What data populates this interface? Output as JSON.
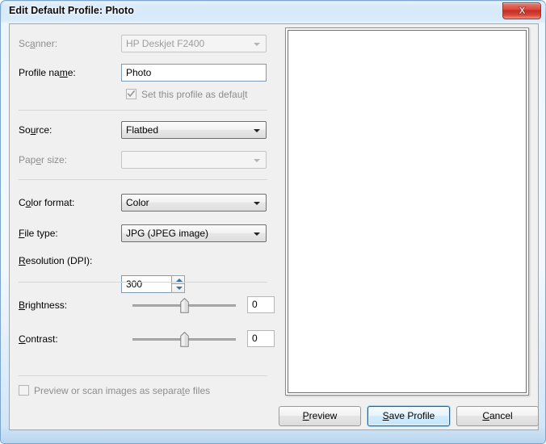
{
  "window": {
    "title": "Edit Default Profile: Photo",
    "close_icon": "close-icon",
    "accent_blue": "#9fd2f2",
    "frame_blue": "#bcd9f4",
    "client_bg": "#f0f0f0",
    "close_red": "#c42b20"
  },
  "fields": {
    "scanner": {
      "label_pre": "Sc",
      "label_accel": "a",
      "label_post": "nner:",
      "value": "HP Deskjet F2400",
      "enabled": false
    },
    "profile_name": {
      "label_pre": "Profile na",
      "label_accel": "m",
      "label_post": "e:",
      "value": "Photo",
      "enabled": true
    },
    "set_default": {
      "label_pre": "Set this profile as defau",
      "label_accel": "l",
      "label_post": "t",
      "checked": true,
      "enabled": false
    },
    "source": {
      "label_pre": "So",
      "label_accel": "u",
      "label_post": "rce:",
      "value": "Flatbed",
      "enabled": true
    },
    "paper_size": {
      "label_pre": "Pap",
      "label_accel": "e",
      "label_post": "r size:",
      "value": "",
      "enabled": false
    },
    "color_format": {
      "label_pre": "C",
      "label_accel": "o",
      "label_post": "lor format:",
      "value": "Color",
      "enabled": true
    },
    "file_type": {
      "label_pre": "",
      "label_accel": "F",
      "label_post": "ile type:",
      "value": "JPG (JPEG image)",
      "enabled": true
    },
    "resolution": {
      "label_pre": "",
      "label_accel": "R",
      "label_post": "esolution (DPI):",
      "value": "300",
      "enabled": true
    },
    "brightness": {
      "label_pre": "",
      "label_accel": "B",
      "label_post": "rightness:",
      "value": "0",
      "slider_percent": 50
    },
    "contrast": {
      "label_pre": "",
      "label_accel": "C",
      "label_post": "ontrast:",
      "value": "0",
      "slider_percent": 50
    },
    "separate_files": {
      "label_pre": "Preview or scan images as separa",
      "label_accel": "t",
      "label_post": "e files",
      "checked": false,
      "enabled": false
    }
  },
  "preview": {
    "name": "preview-pane",
    "empty": true
  },
  "buttons": {
    "preview": {
      "pre": "",
      "accel": "P",
      "post": "review"
    },
    "save": {
      "pre": "",
      "accel": "S",
      "post": "ave Profile",
      "is_default": true
    },
    "cancel": {
      "pre": "",
      "accel": "C",
      "post": "ancel"
    }
  }
}
